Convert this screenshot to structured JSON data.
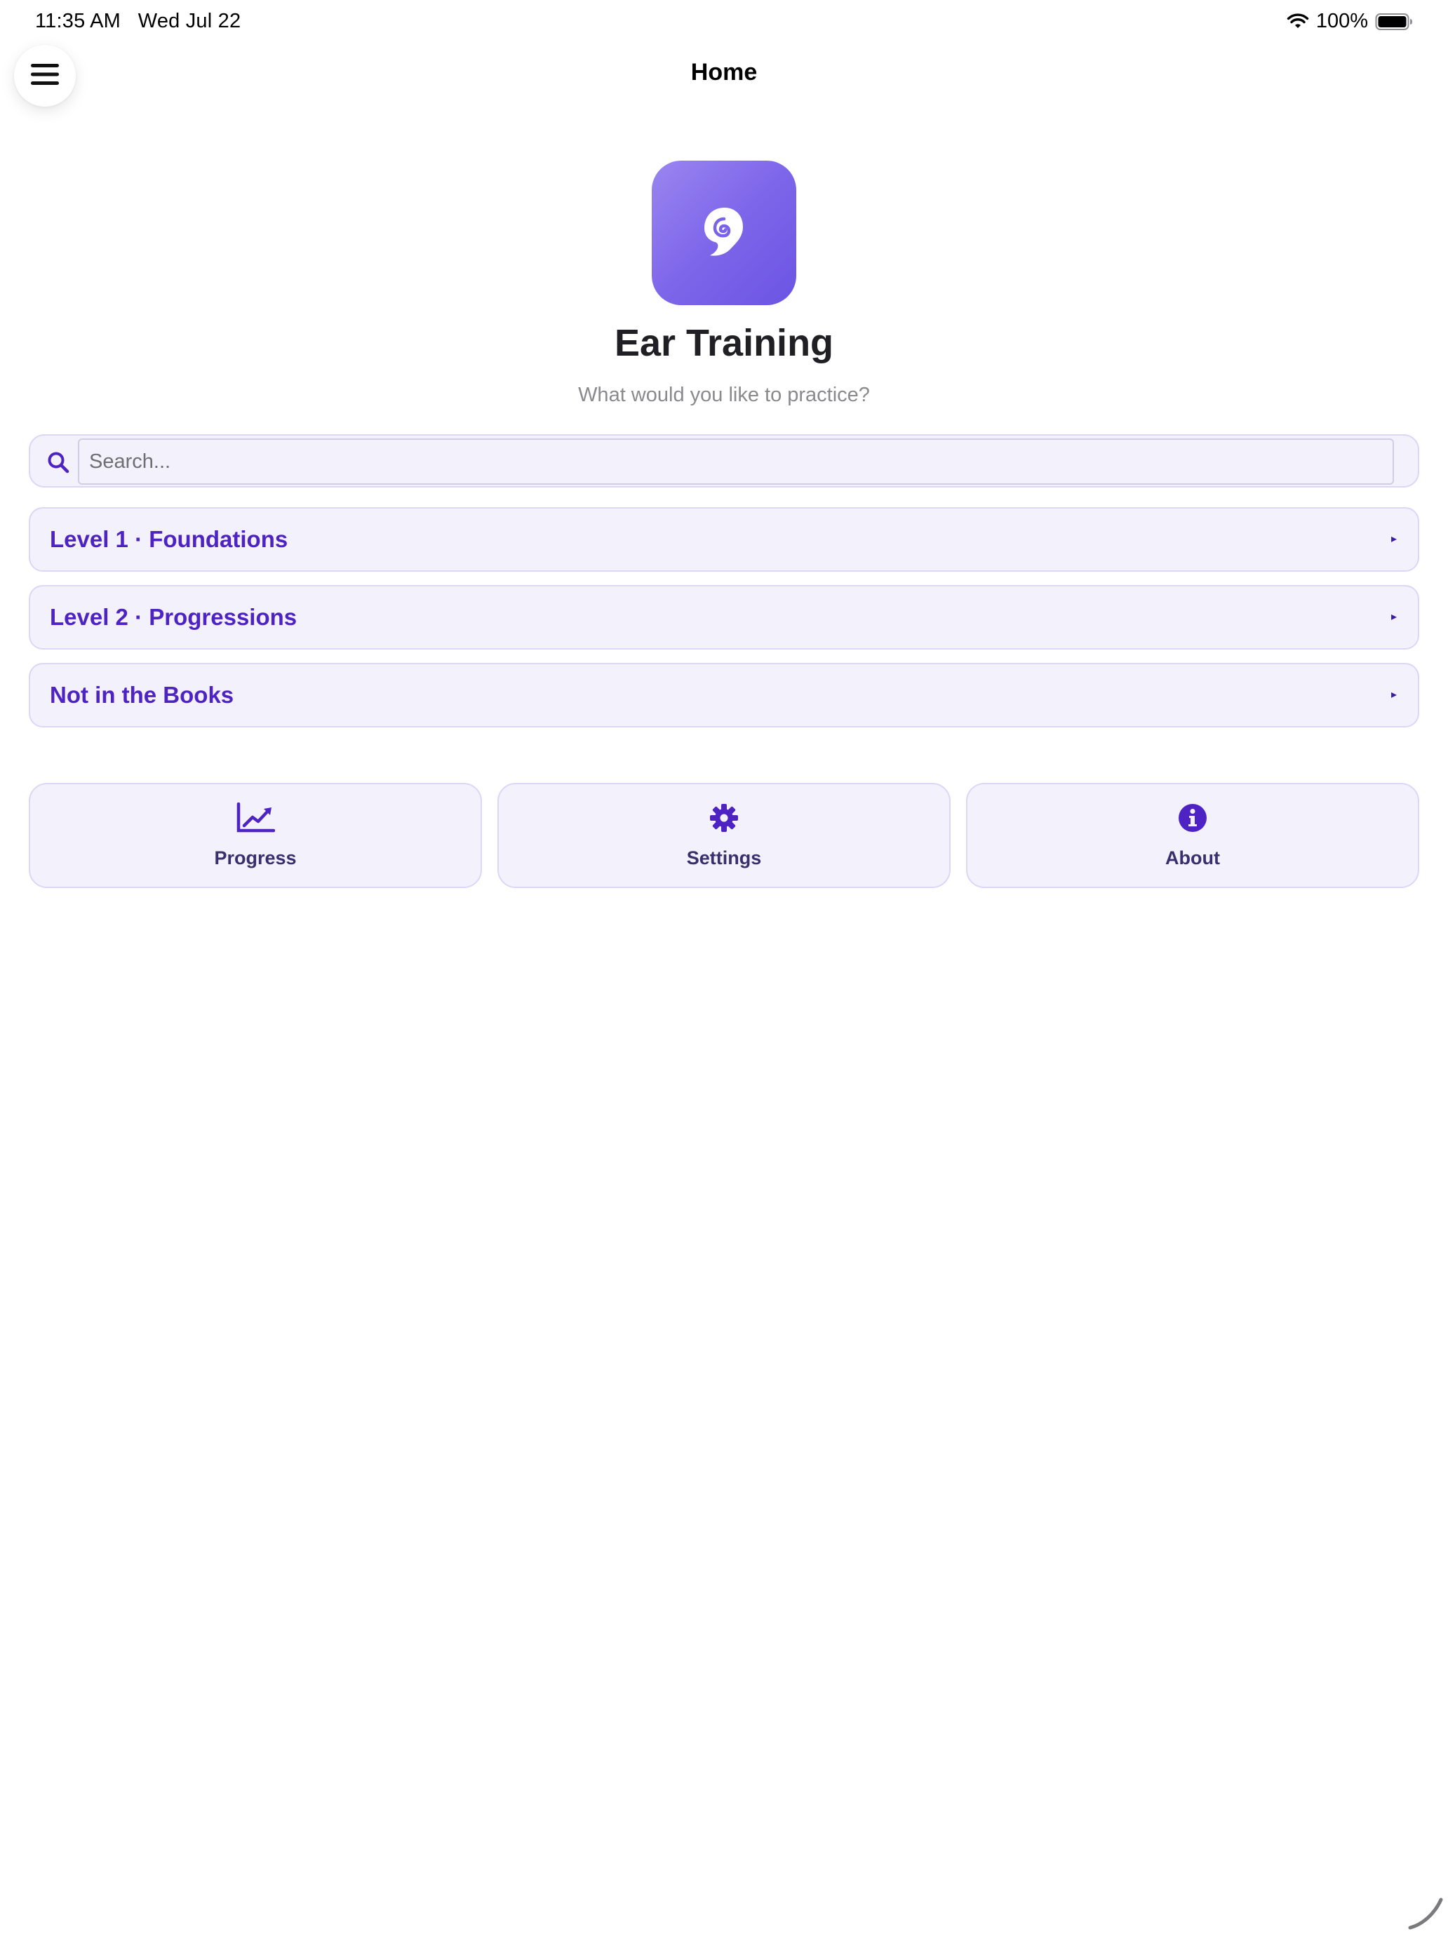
{
  "status_bar": {
    "time": "11:35 AM",
    "date": "Wed Jul 22",
    "battery": "100%",
    "icons": [
      "wifi-icon",
      "battery-icon"
    ]
  },
  "header": {
    "title": "Home",
    "menu_icon": "hamburger-menu-icon"
  },
  "hero": {
    "app_icon": "ear-icon",
    "title": "Ear Training",
    "subtitle": "What would you like to practice?"
  },
  "search": {
    "placeholder": "Search...",
    "value": ""
  },
  "sections": [
    {
      "label": "Level 1 · Foundations",
      "arrow": "▸"
    },
    {
      "label": "Level 2 · Progressions",
      "arrow": "▸"
    },
    {
      "label": "Not in the Books",
      "arrow": "▸"
    }
  ],
  "tiles": [
    {
      "label": "Progress",
      "icon": "chart-line-icon"
    },
    {
      "label": "Settings",
      "icon": "gear-icon"
    },
    {
      "label": "About",
      "icon": "info-icon"
    }
  ],
  "colors": {
    "accent": "#4e23c4",
    "tile_background": "#f3f1fc",
    "tile_border": "#dcd6f7",
    "app_icon_gradient": [
      "#9a86f0",
      "#6b54e3"
    ]
  }
}
